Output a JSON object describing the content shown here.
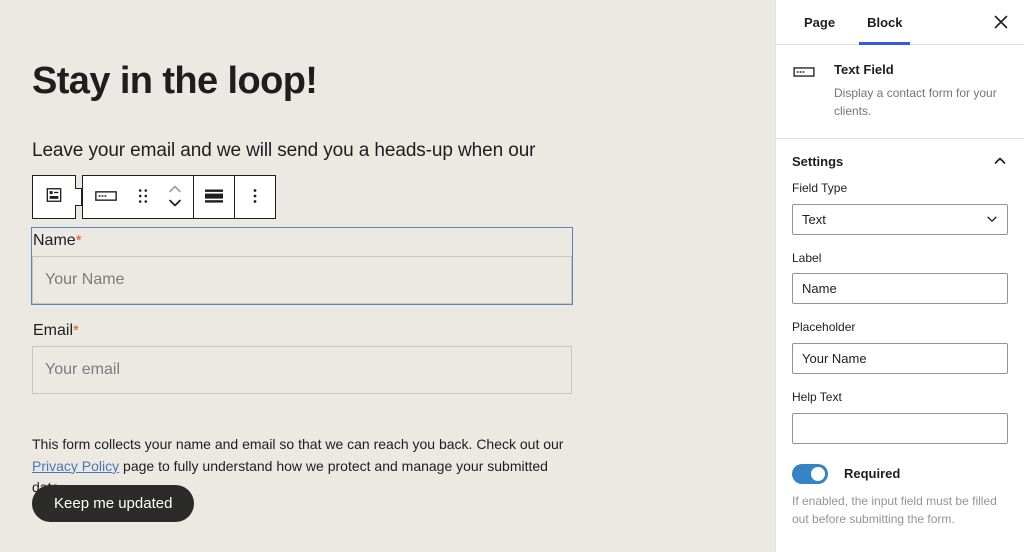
{
  "editor": {
    "post_title": "Stay in the loop!",
    "post_paragraph": "Leave your email and we will send you a heads-up when our",
    "toolbar": {
      "parent_block_label": "Select parent block: Form",
      "block_type_label": "Text Field",
      "drag_label": "Drag",
      "move_up_label": "Move up",
      "move_down_label": "Move down",
      "align_label": "Align",
      "options_label": "Options"
    },
    "form": {
      "name_field": {
        "label": "Name",
        "required_marker": "*",
        "placeholder": "Your Name"
      },
      "email_field": {
        "label": "Email",
        "required_marker": "*",
        "placeholder": "Your email"
      },
      "privacy_text_before": "This form collects your name and email so that we can reach you back. Check out our ",
      "privacy_link": "Privacy Policy",
      "privacy_text_after": " page to fully understand how we protect and manage your submitted data.",
      "submit_label": "Keep me updated"
    }
  },
  "sidebar": {
    "tabs": [
      {
        "label": "Page",
        "active": false
      },
      {
        "label": "Block",
        "active": true
      }
    ],
    "close_label": "Close settings",
    "block_card": {
      "title": "Text Field",
      "description": "Display a contact form for your clients."
    },
    "panel": {
      "title": "Settings",
      "fields": {
        "field_type": {
          "label": "Field Type",
          "value": "Text"
        },
        "label": {
          "label": "Label",
          "value": "Name"
        },
        "placeholder": {
          "label": "Placeholder",
          "value": "Your Name"
        },
        "help_text": {
          "label": "Help Text",
          "value": ""
        }
      },
      "required_toggle": {
        "label": "Required",
        "enabled": true,
        "help": "If enabled, the input field must be filled out before submitting the form."
      }
    }
  },
  "colors": {
    "canvas_bg": "#ece9e3",
    "accent_blue": "#3858e9",
    "toggle_blue": "#3582c4",
    "selection_blue": "#5b86bd",
    "required_red": "#e2562d",
    "link_blue": "#4a76b8",
    "button_dark": "#2b2b28"
  }
}
